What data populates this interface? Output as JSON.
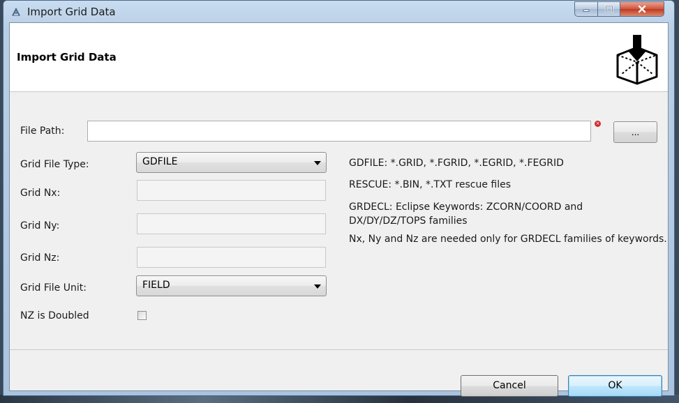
{
  "window": {
    "title": "Import Grid Data"
  },
  "header": {
    "title": "Import Grid Data",
    "icon": "import-grid-icon"
  },
  "file_path": {
    "label": "File Path:",
    "value": "",
    "browse_label": "..."
  },
  "grid_file_type": {
    "label": "Grid File Type:",
    "value": "GDFILE"
  },
  "grid_nx": {
    "label": "Grid Nx:",
    "value": ""
  },
  "grid_ny": {
    "label": "Grid Ny:",
    "value": ""
  },
  "grid_nz": {
    "label": "Grid Nz:",
    "value": ""
  },
  "grid_file_unit": {
    "label": "Grid File Unit:",
    "value": "FIELD"
  },
  "nz_doubled": {
    "label": "NZ is Doubled",
    "checked": false
  },
  "info": {
    "line1": "GDFILE: *.GRID, *.FGRID, *.EGRID, *.FEGRID",
    "line2": "RESCUE: *.BIN, *.TXT rescue files",
    "line3": "GRDECL: Eclipse Keywords: ZCORN/COORD and DX/DY/DZ/TOPS families",
    "line4": "Nx, Ny and Nz are needed only for GRDECL families of keywords."
  },
  "buttons": {
    "cancel": "Cancel",
    "ok": "OK"
  }
}
